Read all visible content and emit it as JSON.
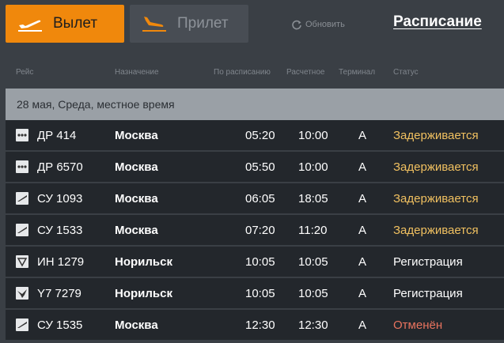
{
  "tabs": {
    "departure": {
      "label": "Вылет",
      "icon": "plane-takeoff-icon"
    },
    "arrival": {
      "label": "Прилет",
      "icon": "plane-landing-icon"
    }
  },
  "refresh": {
    "label": "Обновить",
    "icon": "refresh-icon"
  },
  "schedule_link": "Расписание",
  "columns": {
    "flight": "Рейс",
    "destination": "Назначение",
    "scheduled": "По расписанию",
    "estimated": "Расчетное",
    "terminal": "Терминал",
    "status": "Статус"
  },
  "date_header": "28 мая, Среда, местное время",
  "status_colors": {
    "delayed": "#f0c060",
    "normal": "#ffffff",
    "cancelled": "#e8735e"
  },
  "accent_color": "#f0880c",
  "flights": [
    {
      "flight": "ДР 414",
      "destination": "Москва",
      "scheduled": "05:20",
      "estimated": "10:00",
      "terminal": "A",
      "status": "Задерживается",
      "status_type": "delayed",
      "logo": "airline-logo-dots"
    },
    {
      "flight": "ДР 6570",
      "destination": "Москва",
      "scheduled": "05:50",
      "estimated": "10:00",
      "terminal": "A",
      "status": "Задерживается",
      "status_type": "delayed",
      "logo": "airline-logo-dots"
    },
    {
      "flight": "СУ 1093",
      "destination": "Москва",
      "scheduled": "06:05",
      "estimated": "18:05",
      "terminal": "A",
      "status": "Задерживается",
      "status_type": "delayed",
      "logo": "airline-logo-wing"
    },
    {
      "flight": "СУ 1533",
      "destination": "Москва",
      "scheduled": "07:20",
      "estimated": "11:20",
      "terminal": "A",
      "status": "Задерживается",
      "status_type": "delayed",
      "logo": "airline-logo-wing"
    },
    {
      "flight": "ИН 1279",
      "destination": "Норильск",
      "scheduled": "10:05",
      "estimated": "10:05",
      "terminal": "A",
      "status": "Регистрация",
      "status_type": "normal",
      "logo": "airline-logo-triangle"
    },
    {
      "flight": "Y7 7279",
      "destination": "Норильск",
      "scheduled": "10:05",
      "estimated": "10:05",
      "terminal": "A",
      "status": "Регистрация",
      "status_type": "normal",
      "logo": "airline-logo-bird"
    },
    {
      "flight": "СУ 1535",
      "destination": "Москва",
      "scheduled": "12:30",
      "estimated": "12:30",
      "terminal": "A",
      "status": "Отменён",
      "status_type": "cancelled",
      "logo": "airline-logo-wing"
    }
  ]
}
